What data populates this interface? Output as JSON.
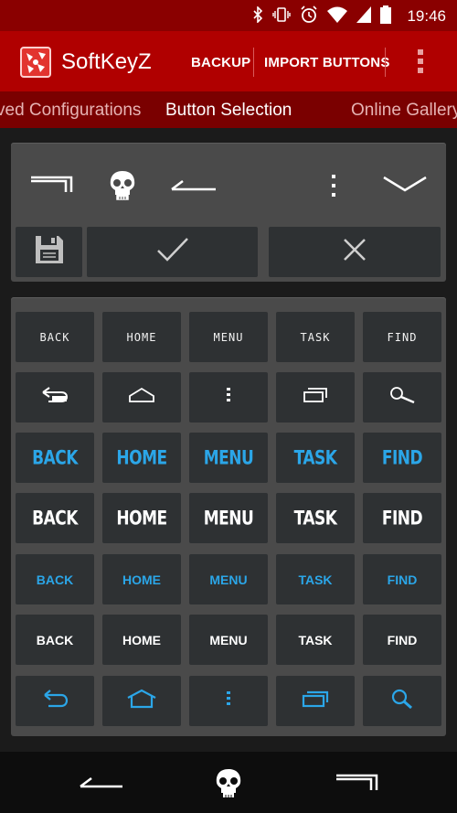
{
  "status": {
    "time": "19:46"
  },
  "app": {
    "name": "SoftKeyZ",
    "actions": {
      "backup": "BACKUP",
      "import": "IMPORT BUTTONS"
    }
  },
  "tabs": [
    "ved Configurations",
    "Button Selection",
    "Online Gallery"
  ],
  "active_tab": 1,
  "preview": {
    "icons": [
      "recent-apps-icon",
      "skull-icon",
      "back-icon",
      "menu-dots-icon",
      "chevron-down-icon"
    ]
  },
  "edit": {
    "icons": [
      "save-icon",
      "check-icon",
      "close-icon"
    ]
  },
  "grid": {
    "rows": [
      {
        "style": "outline",
        "color": "white",
        "labels": [
          "BACK",
          "HOME",
          "MENU",
          "TASK",
          "FIND"
        ]
      },
      {
        "style": "icons",
        "color": "white",
        "icons": [
          "back-icon",
          "home-icon",
          "menu-dots-icon",
          "recent-apps-icon",
          "search-icon"
        ]
      },
      {
        "style": "blocky",
        "color": "blue",
        "labels": [
          "BACK",
          "HOME",
          "MENU",
          "TASK",
          "FIND"
        ]
      },
      {
        "style": "blocky",
        "color": "white",
        "labels": [
          "BACK",
          "HOME",
          "MENU",
          "TASK",
          "FIND"
        ]
      },
      {
        "style": "bold",
        "color": "blue",
        "labels": [
          "BACK",
          "HOME",
          "MENU",
          "TASK",
          "FIND"
        ]
      },
      {
        "style": "bold",
        "color": "white",
        "labels": [
          "BACK",
          "HOME",
          "MENU",
          "TASK",
          "FIND"
        ]
      },
      {
        "style": "icons",
        "color": "blue",
        "icons": [
          "back-icon",
          "home-icon",
          "menu-dots-icon",
          "recent-apps-icon",
          "search-icon"
        ]
      }
    ]
  },
  "colors": {
    "appbar": "#b00000",
    "statusbar": "#8a0000",
    "tabs": "#7a0000",
    "accent_blue": "#2ba6e8",
    "panel": "#4a4a4a",
    "button": "#2e3133"
  },
  "navbar": {
    "icons": [
      "back-icon",
      "skull-icon",
      "recent-apps-icon"
    ]
  }
}
